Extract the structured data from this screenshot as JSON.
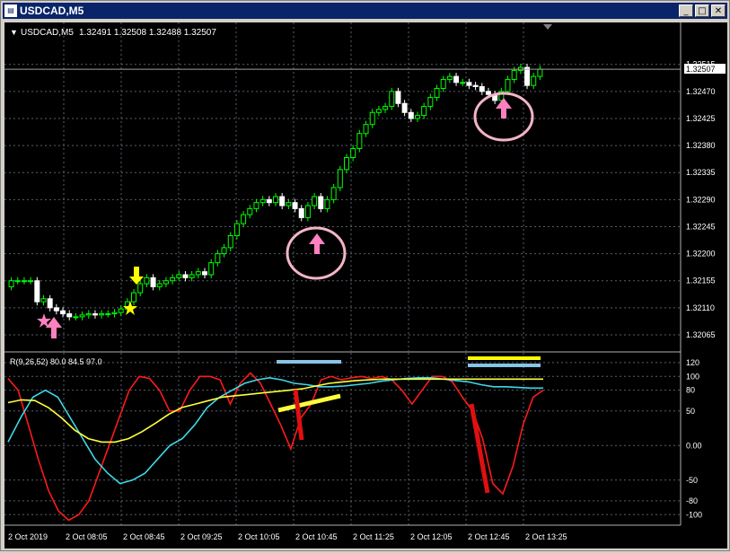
{
  "window": {
    "title": "USDCAD,M5",
    "icon": "chart-window-icon",
    "buttons": {
      "minimize": "0",
      "maximize": "1",
      "close": "r"
    }
  },
  "header": {
    "symbol": "USDCAD,M5",
    "ohlc": "1.32491 1.32508 1.32488 1.32507"
  },
  "indicator": {
    "label": "R(9,26,52) 80.0 84.5 97.0"
  },
  "colors": {
    "background": "#000000",
    "grid": "#5a6470",
    "bull_candle": "#00ff00",
    "bear_candle": "#ffffff",
    "red_line": "#ff1a1a",
    "cyan_line": "#3fd8e8",
    "yellow_line": "#ffff3c",
    "annotation_pink": "#ff80c0",
    "annotation_yellow": "#ffff00",
    "annotation_blue": "#87c5e6",
    "circle": "#f3b5c6"
  },
  "chart_data": {
    "type": "candlestick",
    "price_axis": {
      "ticks": [
        "1.32515",
        "1.32470",
        "1.32425",
        "1.32380",
        "1.32335",
        "1.32290",
        "1.32245",
        "1.32200",
        "1.32155",
        "1.32110",
        "1.32065"
      ],
      "current": "1.32507",
      "range": [
        1.3205,
        1.3254
      ]
    },
    "time_axis": {
      "ticks": [
        "2 Oct 2019",
        "2 Oct 08:05",
        "2 Oct 08:45",
        "2 Oct 09:25",
        "2 Oct 10:05",
        "2 Oct 10:45",
        "2 Oct 11:25",
        "2 Oct 12:05",
        "2 Oct 12:45",
        "2 Oct 13:25"
      ]
    },
    "indicator_axis": {
      "ticks": [
        "120",
        "100",
        "80",
        "50",
        "0.00",
        "-50",
        "-80",
        "-100"
      ],
      "range": [
        -110,
        125
      ]
    },
    "close_series": [
      1.32155,
      1.32155,
      1.32155,
      1.32155,
      1.3212,
      1.32125,
      1.3211,
      1.32105,
      1.321,
      1.32095,
      1.32095,
      1.32098,
      1.321,
      1.32098,
      1.321,
      1.321,
      1.32102,
      1.32108,
      1.3212,
      1.32135,
      1.3215,
      1.3216,
      1.32145,
      1.3215,
      1.32155,
      1.3216,
      1.32165,
      1.3216,
      1.32165,
      1.3217,
      1.32165,
      1.32185,
      1.322,
      1.3221,
      1.3223,
      1.3225,
      1.32265,
      1.32275,
      1.32285,
      1.3229,
      1.32285,
      1.32295,
      1.3228,
      1.32285,
      1.32275,
      1.3226,
      1.3228,
      1.32295,
      1.32275,
      1.3229,
      1.3231,
      1.3234,
      1.3236,
      1.32375,
      1.324,
      1.32415,
      1.32435,
      1.3244,
      1.32445,
      1.3247,
      1.3245,
      1.32435,
      1.32425,
      1.3243,
      1.32445,
      1.3246,
      1.32475,
      1.3249,
      1.32495,
      1.32485,
      1.32485,
      1.3248,
      1.32478,
      1.3247,
      1.32465,
      1.32455,
      1.3247,
      1.3249,
      1.32505,
      1.3251,
      1.3248,
      1.32495,
      1.32507
    ],
    "series": [
      {
        "color": "#ff1a1a",
        "values": [
          97,
          80,
          30,
          -20,
          -65,
          -95,
          -108,
          -100,
          -80,
          -40,
          0,
          40,
          80,
          100,
          97,
          80,
          50,
          50,
          80,
          100,
          100,
          95,
          60,
          90,
          105,
          90,
          60,
          30,
          -5,
          40,
          60,
          95,
          100,
          95,
          98,
          100,
          97,
          100,
          95,
          80,
          60,
          80,
          100,
          100,
          92,
          70,
          50,
          10,
          -55,
          -70,
          -30,
          30,
          70,
          80
        ]
      },
      {
        "color": "#3fd8e8",
        "values": [
          5,
          40,
          70,
          80,
          70,
          40,
          10,
          -20,
          -40,
          -55,
          -50,
          -40,
          -20,
          0,
          10,
          30,
          55,
          70,
          80,
          90,
          95,
          98,
          95,
          90,
          88,
          85,
          85,
          86,
          88,
          90,
          93,
          95,
          97,
          98,
          98,
          96,
          94,
          92,
          88,
          85,
          85,
          84,
          83,
          83
        ]
      },
      {
        "color": "#ffff3c",
        "values": [
          62,
          66,
          65,
          55,
          40,
          22,
          10,
          5,
          5,
          10,
          20,
          32,
          45,
          55,
          60,
          65,
          70,
          72,
          74,
          76,
          78,
          80,
          82,
          86,
          90,
          92,
          94,
          95,
          96,
          96,
          96,
          96,
          96,
          96,
          96,
          96,
          96,
          96,
          96,
          96,
          96
        ]
      }
    ]
  }
}
